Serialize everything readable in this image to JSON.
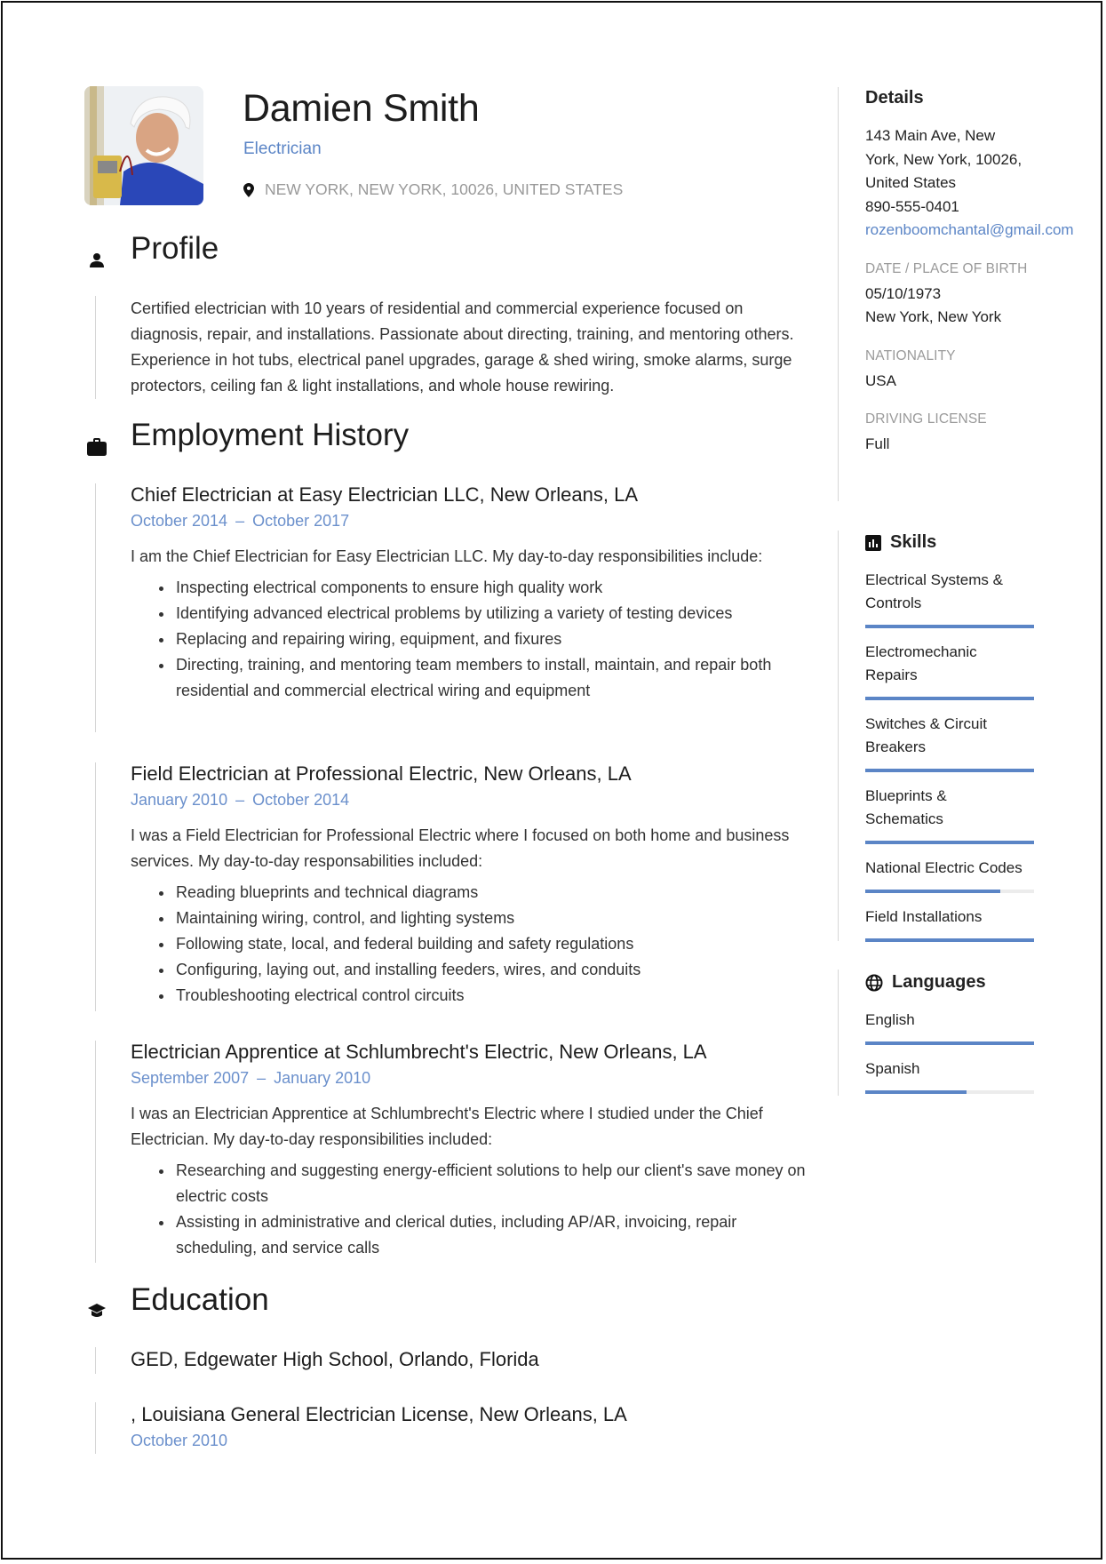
{
  "header": {
    "name": "Damien Smith",
    "job_title": "Electrician",
    "location": "NEW YORK, NEW YORK, 10026, UNITED STATES",
    "photo_alt": "Photo of electrician in hard hat holding a multimeter"
  },
  "profile": {
    "title": "Profile",
    "text": "Certified electrician with 10 years of residential and commercial experience focused on diagnosis, repair, and installations. Passionate about directing, training, and mentoring others. Experience in hot tubs, electrical panel upgrades, garage & shed wiring, smoke alarms, surge protectors, ceiling fan & light installations, and whole house rewiring."
  },
  "employment": {
    "title": "Employment History",
    "jobs": [
      {
        "title": "Chief Electrician at Easy Electrician LLC, New Orleans, LA",
        "start": "October 2014",
        "end": "October 2017",
        "description": "I am the Chief Electrician for Easy Electrician LLC. My day-to-day responsibilities include:",
        "bullets": [
          "Inspecting electrical components to ensure high quality work",
          "Identifying advanced electrical problems by utilizing a variety of testing devices",
          "Replacing and repairing wiring, equipment, and fixures",
          "Directing, training, and mentoring team members to install, maintain, and repair both residential and commercial electrical wiring and equipment"
        ]
      },
      {
        "title": "Field Electrician at Professional Electric, New Orleans, LA",
        "start": "January 2010",
        "end": "October 2014",
        "description": "I was a Field Electrician for Professional Electric where I focused on both home and business services. My day-to-day responsabilities included:",
        "bullets": [
          "Reading blueprints and technical diagrams",
          "Maintaining wiring, control, and lighting systems",
          "Following state, local, and federal building and safety regulations",
          "Configuring, laying out, and installing feeders, wires, and conduits",
          "Troubleshooting electrical control circuits"
        ]
      },
      {
        "title": "Electrician Apprentice at Schlumbrecht's Electric, New Orleans, LA",
        "start": "September 2007",
        "end": "January 2010",
        "description": "I was an Electrician Apprentice at Schlumbrecht's Electric where I studied under the Chief Electrician. My day-to-day responsibilities included:",
        "bullets": [
          "Researching and suggesting energy-efficient solutions to help our client's save money on electric costs",
          "Assisting in administrative and clerical duties, including AP/AR, invoicing, repair scheduling, and service calls"
        ]
      }
    ]
  },
  "education": {
    "title": "Education",
    "items": [
      {
        "title": "GED, Edgewater High School, Orlando, Florida",
        "date": ""
      },
      {
        "title": ", Louisiana General Electrician License, New Orleans, LA",
        "date": "October 2010"
      }
    ]
  },
  "details": {
    "title": "Details",
    "address_line1": "143 Main Ave, New",
    "address_line2": "York, New York, 10026,",
    "address_line3": "United States",
    "phone": "890-555-0401",
    "email": "rozenboomchantal@gmail.com",
    "birth_label": "DATE / PLACE OF BIRTH",
    "birth_date": "05/10/1973",
    "birth_place": "New York, New York",
    "nationality_label": "NATIONALITY",
    "nationality": "USA",
    "license_label": "DRIVING LICENSE",
    "license": "Full"
  },
  "skills": {
    "title": "Skills",
    "items": [
      {
        "line1": "Electrical Systems &",
        "line2": "Controls",
        "level": 1.0
      },
      {
        "line1": "Electromechanic",
        "line2": "Repairs",
        "level": 1.0
      },
      {
        "line1": "Switches & Circuit",
        "line2": "Breakers",
        "level": 1.0
      },
      {
        "line1": "Blueprints &",
        "line2": "Schematics",
        "level": 1.0
      },
      {
        "line1": "National Electric Codes",
        "line2": "",
        "level": 0.8
      },
      {
        "line1": "Field Installations",
        "line2": "",
        "level": 1.0
      }
    ]
  },
  "languages": {
    "title": "Languages",
    "items": [
      {
        "name": "English",
        "level": 1.0
      },
      {
        "name": "Spanish",
        "level": 0.6
      }
    ]
  },
  "colors": {
    "accent": "#5b85c6",
    "bar_track": "#ececec",
    "muted_label": "#9a9a9a"
  }
}
